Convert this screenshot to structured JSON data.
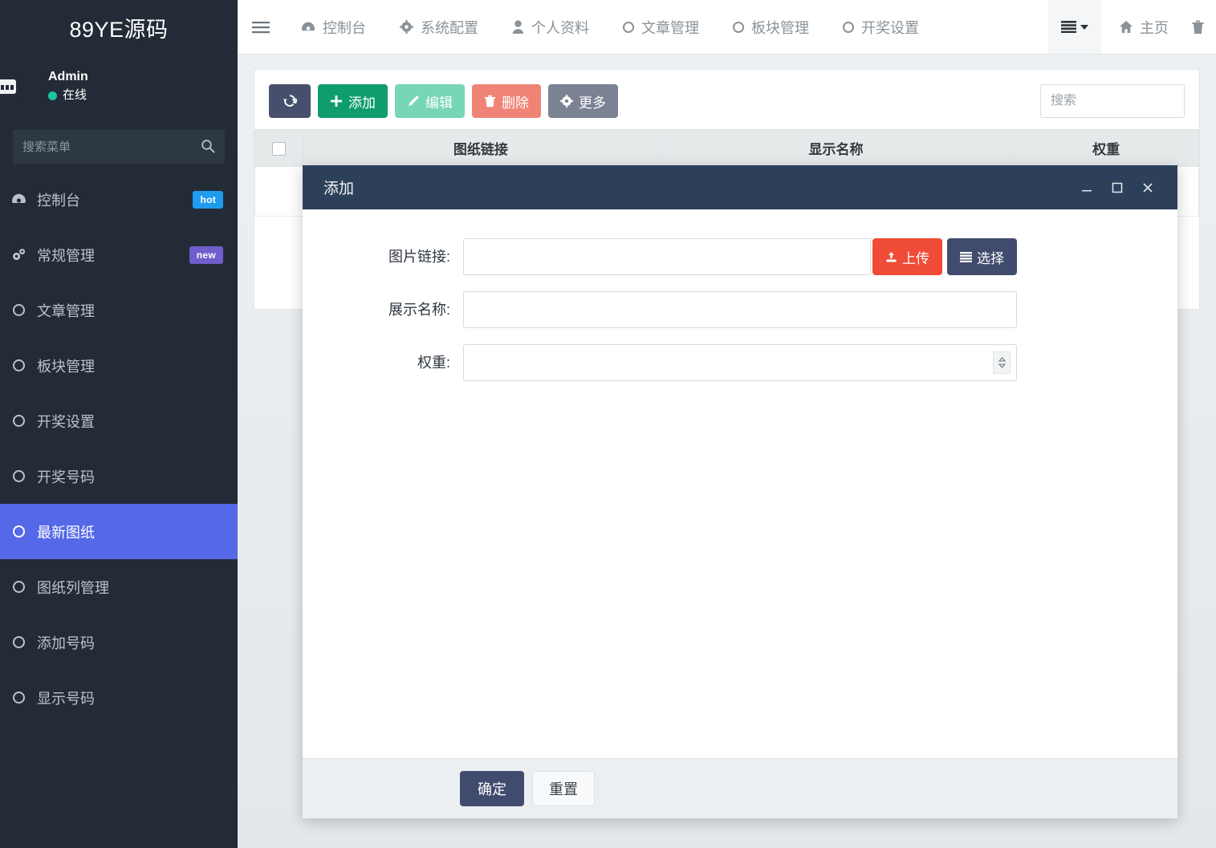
{
  "sidebar": {
    "brand": "89YE源码",
    "user": {
      "name": "Admin",
      "status": "在线",
      "avatar_icon": "user-avatar-icon"
    },
    "search_placeholder": "搜索菜单",
    "search_icon": "search-icon",
    "items": [
      {
        "label": "控制台",
        "icon": "dashboard-icon",
        "badge": "hot",
        "badge_color": "#1f9bf0",
        "active": false
      },
      {
        "label": "常规管理",
        "icon": "cogs-icon",
        "badge": "new",
        "badge_color": "#6f5ecb",
        "active": false
      },
      {
        "label": "文章管理",
        "icon": "circle-icon",
        "badge": "",
        "active": false
      },
      {
        "label": "板块管理",
        "icon": "circle-icon",
        "badge": "",
        "active": false
      },
      {
        "label": "开奖设置",
        "icon": "circle-icon",
        "badge": "",
        "active": false
      },
      {
        "label": "开奖号码",
        "icon": "circle-icon",
        "badge": "",
        "active": false
      },
      {
        "label": "最新图纸",
        "icon": "circle-icon",
        "badge": "",
        "active": true
      },
      {
        "label": "图纸列管理",
        "icon": "circle-icon",
        "badge": "",
        "active": false
      },
      {
        "label": "添加号码",
        "icon": "circle-icon",
        "badge": "",
        "active": false
      },
      {
        "label": "显示号码",
        "icon": "circle-icon",
        "badge": "",
        "active": false
      }
    ]
  },
  "topnav": {
    "toggle_icon": "hamburger-icon",
    "items": [
      {
        "label": "控制台",
        "icon": "dashboard-icon"
      },
      {
        "label": "系统配置",
        "icon": "gear-icon"
      },
      {
        "label": "个人资料",
        "icon": "user-icon"
      },
      {
        "label": "文章管理",
        "icon": "circle-icon"
      },
      {
        "label": "板块管理",
        "icon": "circle-icon"
      },
      {
        "label": "开奖设置",
        "icon": "circle-icon"
      }
    ],
    "menu_button_icon": "list-icon",
    "home_label": "主页",
    "home_icon": "home-icon",
    "trash_icon": "trash-icon"
  },
  "toolbar": {
    "refresh_icon": "refresh-icon",
    "buttons": [
      {
        "label": "添加",
        "icon": "plus-icon",
        "color": "#0f9d6e"
      },
      {
        "label": "编辑",
        "icon": "pencil-icon",
        "color": "#77d6b5"
      },
      {
        "label": "删除",
        "icon": "trash-icon",
        "color": "#ef8476"
      },
      {
        "label": "更多",
        "icon": "gear-icon",
        "color": "#7b8294"
      }
    ],
    "search_placeholder": "搜索"
  },
  "table": {
    "columns": [
      "",
      "图纸链接",
      "显示名称",
      "权重"
    ],
    "rows": []
  },
  "modal": {
    "title": "添加",
    "window_controls": {
      "minimize_icon": "minimize-icon",
      "maximize_icon": "maximize-icon",
      "close_icon": "close-icon"
    },
    "fields": [
      {
        "label": "图片链接:",
        "value": "",
        "placeholder": "",
        "type": "text-with-buttons",
        "buttons": [
          {
            "label": "上传",
            "icon": "upload-icon",
            "color": "#ef4b36"
          },
          {
            "label": "选择",
            "icon": "list-icon",
            "color": "#414b6e"
          }
        ]
      },
      {
        "label": "展示名称:",
        "value": "",
        "placeholder": "",
        "type": "text"
      },
      {
        "label": "权重:",
        "value": "",
        "placeholder": "",
        "type": "number"
      }
    ],
    "footer": {
      "confirm_label": "确定",
      "reset_label": "重置"
    }
  },
  "colors": {
    "sidebar_bg": "#232c36",
    "sidebar_active": "#5468e8",
    "modal_header": "#2d405a",
    "accent_green": "#0f9d6e",
    "accent_red": "#ef4b36",
    "accent_navy": "#414b6e",
    "status_online": "#1bc5a3"
  }
}
